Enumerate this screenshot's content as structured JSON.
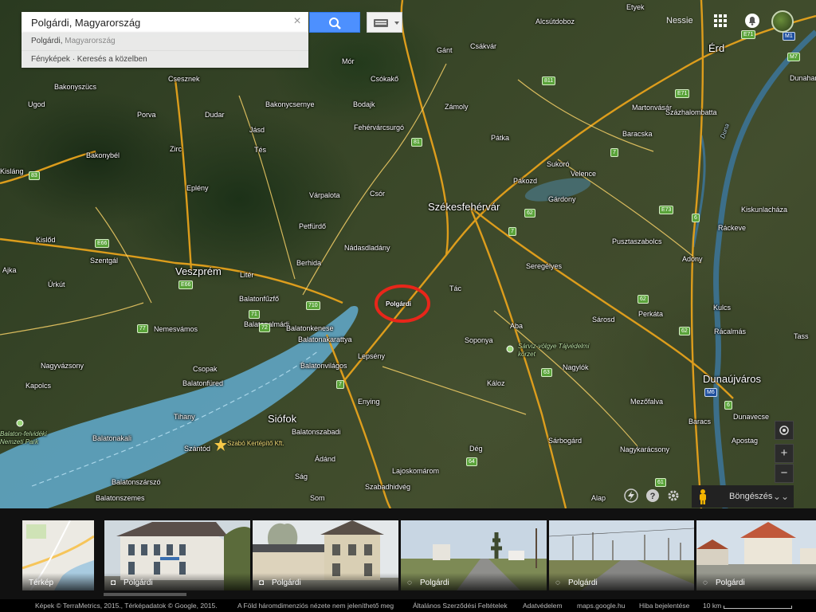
{
  "search": {
    "value": "Polgárdi, Magyarország",
    "clear_icon": "close-icon",
    "search_icon": "search-icon",
    "keyboard_icon": "keyboard-icon",
    "suggestions": [
      {
        "main": "Polgárdi,",
        "secondary": " Magyarország"
      },
      {
        "main": "Fényképek · Keresés a közelben",
        "secondary": ""
      }
    ]
  },
  "user": {
    "name": "Nessie",
    "apps_icon": "apps-grid-icon",
    "bell_icon": "notification-icon"
  },
  "map": {
    "cities": [
      {
        "name": "Székesfehérvár",
        "cls": "big"
      },
      {
        "name": "Veszprém",
        "cls": "big"
      },
      {
        "name": "Siófok",
        "cls": "big"
      },
      {
        "name": "Dunaújváros",
        "cls": "big"
      },
      {
        "name": "Érd",
        "cls": "big"
      },
      {
        "name": "Polgárdi",
        "cls": "city"
      }
    ],
    "towns": [
      "Etyek",
      "Alcsútdoboz",
      "Csákvár",
      "Gánt",
      "Mór",
      "Csókakő",
      "Bodajk",
      "Zámoly",
      "Fehérvárcsurgó",
      "Pátka",
      "Martonvásár",
      "Százhalombatta",
      "Baracska",
      "Csesznek",
      "Bakonyszücs",
      "Ugod",
      "Porva",
      "Dudar",
      "Bakonycsernye",
      "Jásd",
      "Bakonybél",
      "Zirc",
      "Tés",
      "Sukoró",
      "Velence",
      "Pákozd",
      "Gárdony",
      "Eplény",
      "Várpalota",
      "Csór",
      "Kisláng",
      "Kislőd",
      "Szentgál",
      "Ajka",
      "Úrkút",
      "Nemesvámos",
      "Litér",
      "Berhida",
      "Petfürdő",
      "Nádasdladány",
      "Balatonfűzfő",
      "Balatonalmádi",
      "Balatonkenese",
      "Balatonakarattya",
      "Balatonvilágos",
      "Lepsény",
      "Enying",
      "Tác",
      "Seregélyes",
      "Pusztaszabolcs",
      "Adony",
      "Kulcs",
      "Rácalmás",
      "Kiskunlacháza",
      "Ráckeve",
      "Sárosd",
      "Perkáta",
      "Aba",
      "Soponya",
      "Nagylók",
      "Káloz",
      "Mezőfalva",
      "Baracs",
      "Dunavecse",
      "Apostag",
      "Tass",
      "Nagyvázsony",
      "Kapolcs",
      "Balatonfüred",
      "Csopak",
      "Tihany",
      "Balatonakali",
      "Szántód",
      "Balatonszabadi",
      "Ádánd",
      "Ság",
      "Dég",
      "Lajoskomárom",
      "Szabadhidvég",
      "Balatonszárszó",
      "Balatonszemes",
      "Som",
      "Alap",
      "Sárbogárd",
      "Nagykarácsony",
      "Dunaharaszti"
    ],
    "parks": [
      "Sárvíz-völgye Tájvédelmi körzet",
      "Balaton-felvidéki Nemzeti Park"
    ],
    "places": [
      "Szabó Kertépítő Kft."
    ],
    "roads": [
      "M1",
      "E71",
      "M7",
      "E71",
      "7",
      "81",
      "811",
      "62",
      "7",
      "E73",
      "6",
      "6",
      "62",
      "63",
      "M6",
      "710",
      "71",
      "72",
      "77",
      "E66",
      "E66",
      "83",
      "7",
      "64",
      "61",
      "62"
    ],
    "river": "Duna"
  },
  "controls": {
    "locate_icon": "my-location-icon",
    "zoom_in": "+",
    "zoom_out": "−",
    "browse_label": "Böngészés",
    "browse_chevron": "chevron-down-icon",
    "pegman_icon": "pegman-icon",
    "weather_icon": "lightning-icon",
    "help_icon": "help-icon",
    "settings_icon": "gear-icon"
  },
  "filmstrip": [
    {
      "label": "Térkép",
      "kind": "map"
    },
    {
      "label": "Polgárdi",
      "kind": "photo"
    },
    {
      "label": "Polgárdi",
      "kind": "photo"
    },
    {
      "label": "Polgárdi",
      "kind": "streetview"
    },
    {
      "label": "Polgárdi",
      "kind": "streetview"
    },
    {
      "label": "Polgárdi",
      "kind": "streetview"
    }
  ],
  "footer": {
    "imagery": "Képek © TerraMetrics, 2015., Térképadatok © Google, 2015.",
    "notice": "A Föld háromdimenziós nézete nem jeleníthető meg",
    "terms": "Általános Szerződési Feltételek",
    "privacy": "Adatvédelem",
    "site": "maps.google.hu",
    "report": "Hiba bejelentése",
    "scale": "10 km"
  },
  "colors": {
    "accent": "#4d90fe",
    "highlight_circle": "#e8261a",
    "lake": "#5fa5c4"
  }
}
